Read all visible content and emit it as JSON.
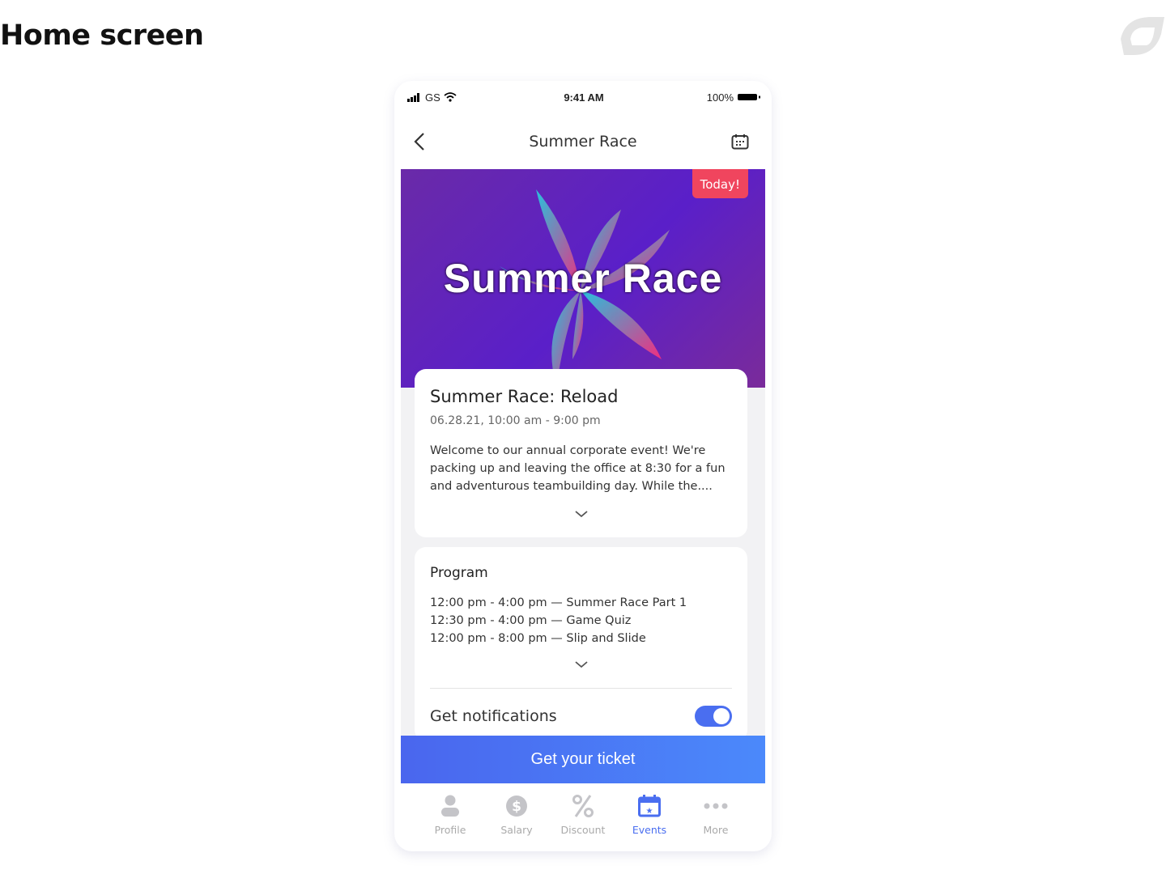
{
  "page": {
    "title": "Home screen"
  },
  "status": {
    "carrier": "GS",
    "time": "9:41 AM",
    "battery": "100%"
  },
  "nav": {
    "title": "Summer Race"
  },
  "hero": {
    "wordmark": "Summer Race",
    "badge": "Today!"
  },
  "event": {
    "title": "Summer Race: Reload",
    "date": "06.28.21, 10:00 am - 9:00 pm",
    "description": "Welcome to our annual corporate event! We're packing up and leaving the office at 8:30 for a fun and adventurous teambuilding day. While the...."
  },
  "program": {
    "title": "Program",
    "items": [
      "12:00 pm - 4:00 pm — Summer Race Part 1",
      "12:30 pm - 4:00 pm — Game Quiz",
      "12:00 pm - 8:00 pm — Slip and Slide"
    ]
  },
  "notifications": {
    "label": "Get notifications",
    "enabled": true
  },
  "cta": {
    "label": "Get your ticket"
  },
  "tabs": [
    {
      "label": "Profile",
      "icon": "person-icon"
    },
    {
      "label": "Salary",
      "icon": "dollar-icon"
    },
    {
      "label": "Discount",
      "icon": "percent-icon"
    },
    {
      "label": "Events",
      "icon": "calendar-star-icon",
      "active": true
    },
    {
      "label": "More",
      "icon": "more-icon"
    }
  ],
  "colors": {
    "accent": "#4a6ef0",
    "badge": "#f0455e",
    "hero": "#5a1fc9"
  }
}
